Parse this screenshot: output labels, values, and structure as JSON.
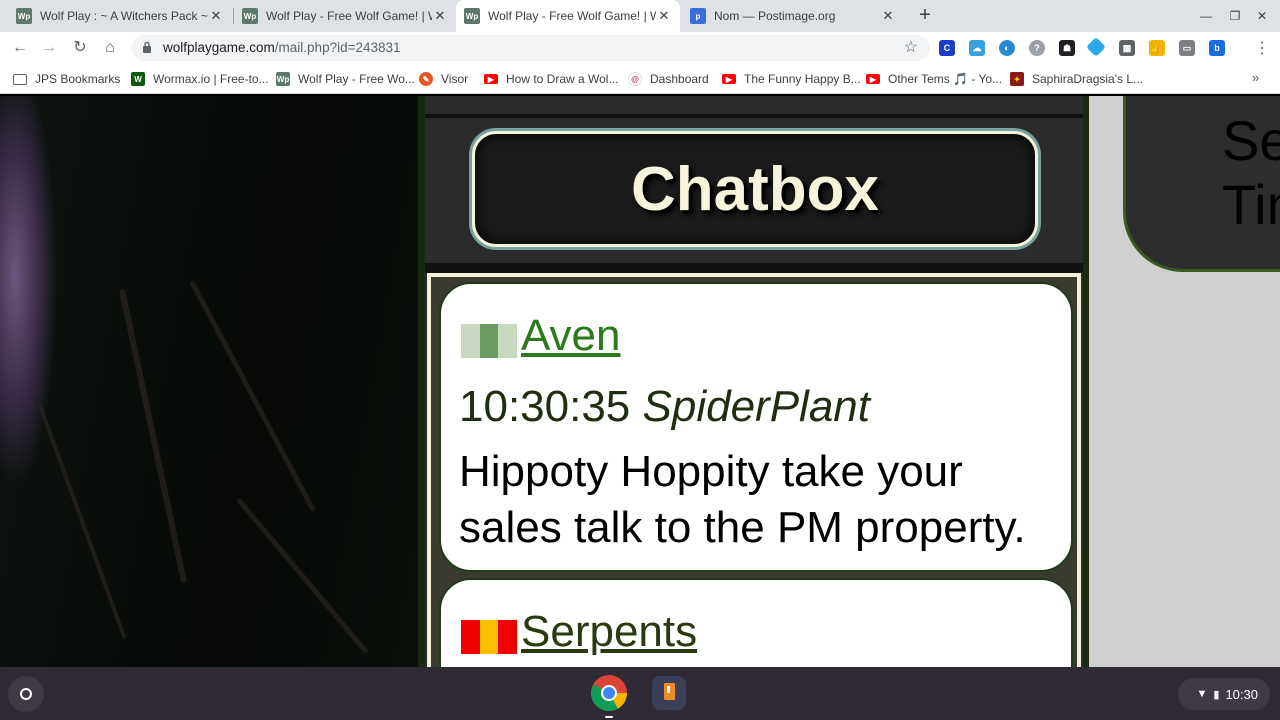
{
  "browser": {
    "tabs": [
      {
        "title": "Wolf Play : ~ A Witchers Pack ~",
        "icon": "wolfplay-favicon",
        "active": false
      },
      {
        "title": "Wolf Play - Free Wolf Game! | Wo",
        "icon": "wolfplay-favicon",
        "active": false
      },
      {
        "title": "Wolf Play - Free Wolf Game! | Wo",
        "icon": "wolfplay-favicon",
        "active": true
      },
      {
        "title": "Nom — Postimage.org",
        "icon": "postimage-favicon",
        "active": false
      }
    ],
    "new_tab": "+",
    "url_host": "wolfplaygame.com",
    "url_path": "/mail.php?id=243831",
    "bookmarks": [
      {
        "label": "JPS Bookmarks",
        "icon": "folder-icon"
      },
      {
        "label": "Wormax.io | Free-to...",
        "icon": "wormax-icon"
      },
      {
        "label": "Wolf Play - Free Wo...",
        "icon": "wolfplay-favicon"
      },
      {
        "label": "Visor",
        "icon": "visor-icon"
      },
      {
        "label": "How to Draw a Wol...",
        "icon": "youtube-icon"
      },
      {
        "label": "Dashboard",
        "icon": "dashboard-icon"
      },
      {
        "label": "The Funny Happy B...",
        "icon": "youtube-icon"
      },
      {
        "label": "Other Tems 🎵 - Yo...",
        "icon": "youtube-icon"
      },
      {
        "label": "SaphiraDragsia's L...",
        "icon": "saphira-icon"
      }
    ],
    "bookmarks_more": "»"
  },
  "page": {
    "chatbox_title": "Chatbox",
    "messages": [
      {
        "pack": "Aven",
        "pack_colors": [
          "#c8d8c0",
          "#6a9a60",
          "#c8d8c0"
        ],
        "name_color": "#2a7a1a",
        "time": "10:30:35",
        "author": "SpiderPlant",
        "text": "Hippoty Hoppity take your sales talk to the PM property."
      },
      {
        "pack": "Serpents",
        "pack_colors": [
          "#f00000",
          "#f8c000",
          "#f00000"
        ],
        "name_color": "#2a3a10"
      }
    ],
    "side_text_line1": "Seas",
    "side_text_line2": "Time"
  },
  "shelf": {
    "apps": [
      "chrome-icon",
      "notes-app-icon"
    ],
    "clock": "10:30"
  }
}
